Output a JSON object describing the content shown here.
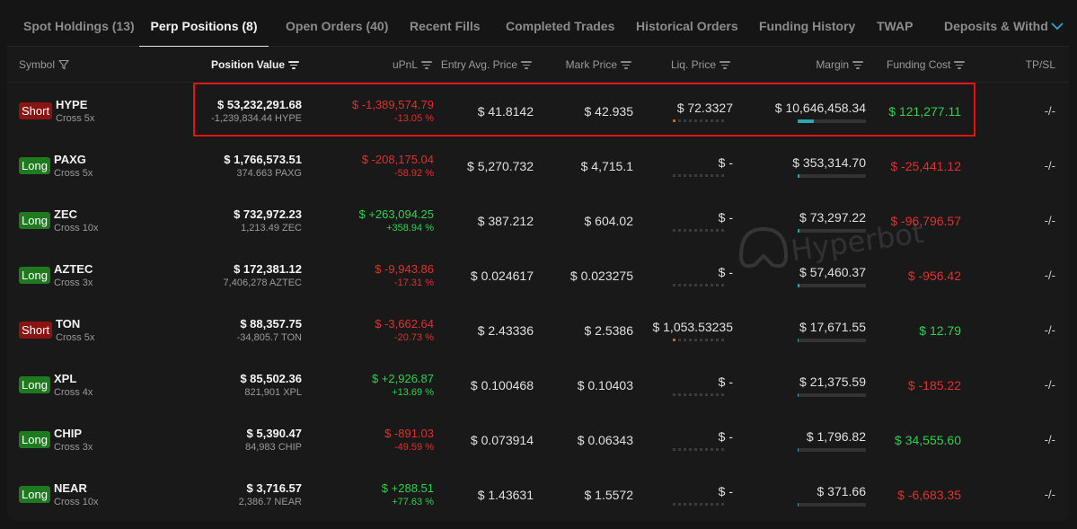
{
  "tabs": [
    {
      "label": "Spot Holdings (13)",
      "active": false
    },
    {
      "label": "Perp Positions (8)",
      "active": true
    },
    {
      "label": "Open Orders (40)",
      "active": false
    },
    {
      "label": "Recent Fills",
      "active": false
    },
    {
      "label": "Completed Trades",
      "active": false
    },
    {
      "label": "Historical Orders",
      "active": false
    },
    {
      "label": "Funding History",
      "active": false
    },
    {
      "label": "TWAP",
      "active": false
    },
    {
      "label": "Deposits & Withd",
      "active": false
    }
  ],
  "headers": {
    "symbol": "Symbol",
    "position_value": "Position Value",
    "upnl": "uPnL",
    "entry": "Entry Avg. Price",
    "mark": "Mark Price",
    "liq": "Liq. Price",
    "margin": "Margin",
    "funding": "Funding Cost",
    "tpsl": "TP/SL"
  },
  "watermark": "Hyperbot",
  "colors": {
    "long": "#1f7a1f",
    "short": "#8a1414",
    "positive": "#2fcf4f",
    "negative": "#e0302f",
    "margin_bar": "#2aa7b0",
    "highlight": "#e01414"
  },
  "positions": [
    {
      "side": "Short",
      "symbol": "HYPE",
      "leverage": "Cross 5x",
      "value": "$ 53,232,291.68",
      "size": "-1,239,834.44 HYPE",
      "upnl": "$ -1,389,574.79",
      "upnl_pct": "-13.05 %",
      "upnl_positive": false,
      "entry": "$ 41.8142",
      "mark": "$ 42.935",
      "liq": "$ 72.3327",
      "liq_risk_level": 1,
      "margin": "$ 10,646,458.34",
      "margin_fill": 0.24,
      "funding": "$ 121,277.11",
      "funding_positive": true,
      "tpsl": "-/-"
    },
    {
      "side": "Long",
      "symbol": "PAXG",
      "leverage": "Cross 5x",
      "value": "$ 1,766,573.51",
      "size": "374.663 PAXG",
      "upnl": "$ -208,175.04",
      "upnl_pct": "-58.92 %",
      "upnl_positive": false,
      "entry": "$ 5,270.732",
      "mark": "$ 4,715.1",
      "liq": "$ -",
      "liq_risk_level": 0,
      "margin": "$ 353,314.70",
      "margin_fill": 0.02,
      "funding": "$ -25,441.12",
      "funding_positive": false,
      "tpsl": "-/-"
    },
    {
      "side": "Long",
      "symbol": "ZEC",
      "leverage": "Cross 10x",
      "value": "$ 732,972.23",
      "size": "1,213.49 ZEC",
      "upnl": "$ +263,094.25",
      "upnl_pct": "+358.94 %",
      "upnl_positive": true,
      "entry": "$ 387.212",
      "mark": "$ 604.02",
      "liq": "$ -",
      "liq_risk_level": 0,
      "margin": "$ 73,297.22",
      "margin_fill": 0.02,
      "funding": "$ -96,796.57",
      "funding_positive": false,
      "tpsl": "-/-"
    },
    {
      "side": "Long",
      "symbol": "AZTEC",
      "leverage": "Cross 3x",
      "value": "$ 172,381.12",
      "size": "7,406,278 AZTEC",
      "upnl": "$ -9,943.86",
      "upnl_pct": "-17.31 %",
      "upnl_positive": false,
      "entry": "$ 0.024617",
      "mark": "$ 0.023275",
      "liq": "$ -",
      "liq_risk_level": 0,
      "margin": "$ 57,460.37",
      "margin_fill": 0.02,
      "funding": "$ -956.42",
      "funding_positive": false,
      "tpsl": "-/-"
    },
    {
      "side": "Short",
      "symbol": "TON",
      "leverage": "Cross 5x",
      "value": "$ 88,357.75",
      "size": "-34,805.7 TON",
      "upnl": "$ -3,662.64",
      "upnl_pct": "-20.73 %",
      "upnl_positive": false,
      "entry": "$ 2.43336",
      "mark": "$ 2.5386",
      "liq": "$ 1,053.53235",
      "liq_risk_level": 1,
      "margin": "$ 17,671.55",
      "margin_fill": 0.01,
      "funding": "$ 12.79",
      "funding_positive": true,
      "tpsl": "-/-"
    },
    {
      "side": "Long",
      "symbol": "XPL",
      "leverage": "Cross 4x",
      "value": "$ 85,502.36",
      "size": "821,901 XPL",
      "upnl": "$ +2,926.87",
      "upnl_pct": "+13.69 %",
      "upnl_positive": true,
      "entry": "$ 0.100468",
      "mark": "$ 0.10403",
      "liq": "$ -",
      "liq_risk_level": 0,
      "margin": "$ 21,375.59",
      "margin_fill": 0.01,
      "funding": "$ -185.22",
      "funding_positive": false,
      "tpsl": "-/-"
    },
    {
      "side": "Long",
      "symbol": "CHIP",
      "leverage": "Cross 3x",
      "value": "$ 5,390.47",
      "size": "84,983 CHIP",
      "upnl": "$ -891.03",
      "upnl_pct": "-49.59 %",
      "upnl_positive": false,
      "entry": "$ 0.073914",
      "mark": "$ 0.06343",
      "liq": "$ -",
      "liq_risk_level": 0,
      "margin": "$ 1,796.82",
      "margin_fill": 0.01,
      "funding": "$ 34,555.60",
      "funding_positive": true,
      "tpsl": "-/-"
    },
    {
      "side": "Long",
      "symbol": "NEAR",
      "leverage": "Cross 10x",
      "value": "$ 3,716.57",
      "size": "2,386.7 NEAR",
      "upnl": "$ +288.51",
      "upnl_pct": "+77.63 %",
      "upnl_positive": true,
      "entry": "$ 1.43631",
      "mark": "$ 1.5572",
      "liq": "$ -",
      "liq_risk_level": 0,
      "margin": "$ 371.66",
      "margin_fill": 0.01,
      "funding": "$ -6,683.35",
      "funding_positive": false,
      "tpsl": "-/-"
    }
  ]
}
